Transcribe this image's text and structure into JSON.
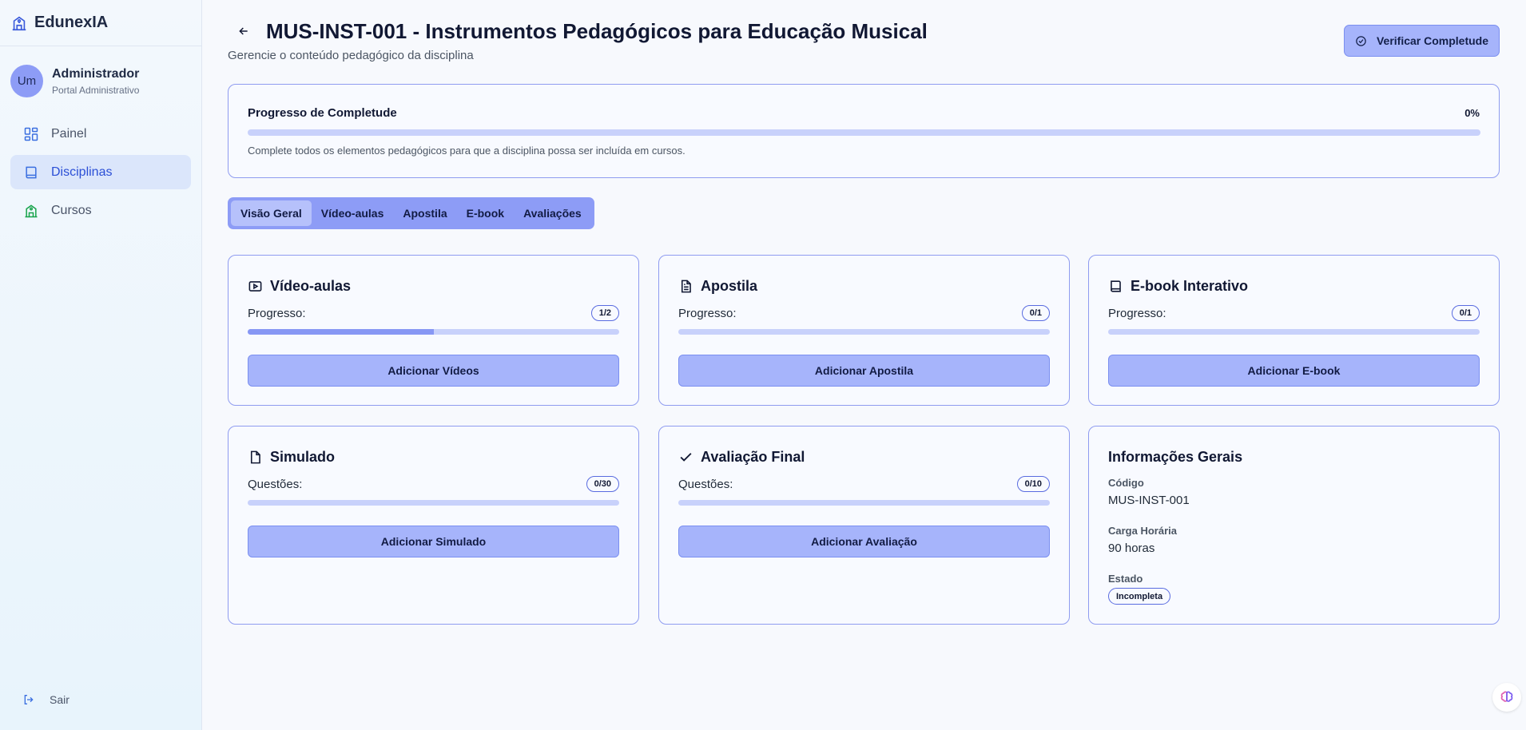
{
  "app": {
    "brand": "EdunexIA"
  },
  "user": {
    "avatar_initials": "Um",
    "name": "Administrador",
    "role": "Portal Administrativo"
  },
  "sidebar": {
    "items": [
      {
        "label": "Painel",
        "icon": "dashboard-icon",
        "active": false
      },
      {
        "label": "Disciplinas",
        "icon": "book-icon",
        "active": true
      },
      {
        "label": "Cursos",
        "icon": "school-icon",
        "active": false
      }
    ],
    "logout_label": "Sair"
  },
  "header": {
    "title": "MUS-INST-001 - Instrumentos Pedagógicos para Educação Musical",
    "subtitle": "Gerencie o conteúdo pedagógico da disciplina",
    "verify_button": "Verificar Completude"
  },
  "completeness": {
    "title": "Progresso de Completude",
    "percent_label": "0%",
    "percent": 0,
    "note": "Complete todos os elementos pedagógicos para que a disciplina possa ser incluída em cursos."
  },
  "tabs": [
    {
      "label": "Visão Geral",
      "active": true
    },
    {
      "label": "Vídeo-aulas",
      "active": false
    },
    {
      "label": "Apostila",
      "active": false
    },
    {
      "label": "E-book",
      "active": false
    },
    {
      "label": "Avaliações",
      "active": false
    }
  ],
  "cards": {
    "videos": {
      "title": "Vídeo-aulas",
      "label": "Progresso:",
      "badge": "1/2",
      "progress": 0.5,
      "button": "Adicionar Vídeos",
      "icon": "video-icon"
    },
    "apostila": {
      "title": "Apostila",
      "label": "Progresso:",
      "badge": "0/1",
      "progress": 0,
      "button": "Adicionar Apostila",
      "icon": "document-icon"
    },
    "ebook": {
      "title": "E-book Interativo",
      "label": "Progresso:",
      "badge": "0/1",
      "progress": 0,
      "button": "Adicionar E-book",
      "icon": "book-icon"
    },
    "simulado": {
      "title": "Simulado",
      "label": "Questões:",
      "badge": "0/30",
      "progress": 0,
      "button": "Adicionar Simulado",
      "icon": "file-icon"
    },
    "avaliacao": {
      "title": "Avaliação Final",
      "label": "Questões:",
      "badge": "0/10",
      "progress": 0,
      "button": "Adicionar Avaliação",
      "icon": "check-icon"
    }
  },
  "info": {
    "title": "Informações Gerais",
    "code_label": "Código",
    "code": "MUS-INST-001",
    "hours_label": "Carga Horária",
    "hours": "90 horas",
    "status_label": "Estado",
    "status": "Incompleta"
  },
  "colors": {
    "accent": "#8d9cf6",
    "button": "#a6b4fb",
    "border": "#8f9cf0",
    "active_nav": "#2b4fd6"
  }
}
